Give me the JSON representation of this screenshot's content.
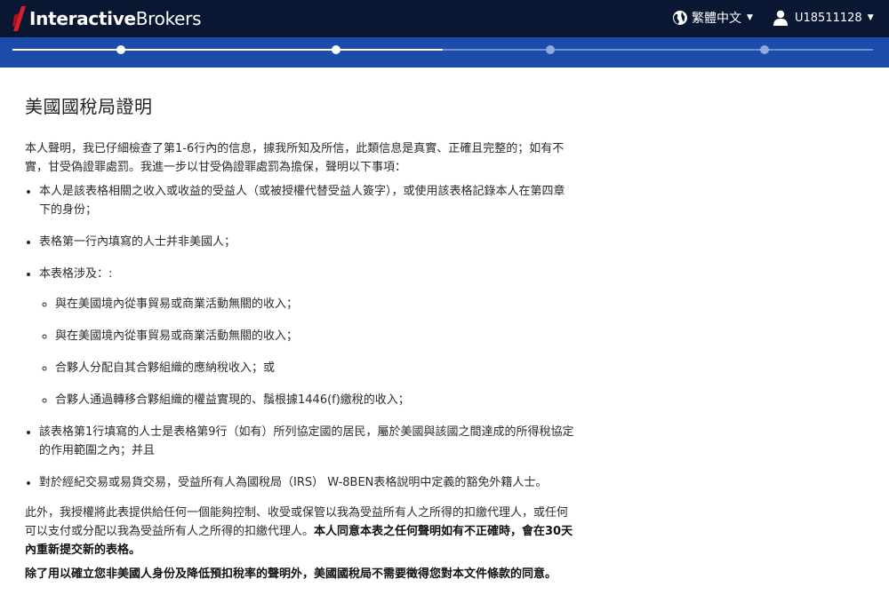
{
  "header": {
    "brand_bold": "Interactive",
    "brand_light": "Brokers",
    "language": "繁體中文",
    "username": "U18511128"
  },
  "progress": {
    "steps_total": 4,
    "steps_completed": 2,
    "fraction": 0.5
  },
  "page": {
    "title": "美國國稅局證明",
    "intro": "本人聲明，我已仔細檢查了第1-6行內的信息，據我所知及所信，此類信息是真實、正確且完整的；如有不實，甘受偽證罪處罰。我進一步以甘受偽證罪處罰為擔保，聲明以下事項：",
    "bullets": {
      "b1": "本人是該表格相關之收入或收益的受益人（或被授權代替受益人簽字），或使用該表格記錄本人在第四章下的身份；",
      "b2": "表格第一行內填寫的人士并非美國人；",
      "b3": "本表格涉及：:",
      "b4": "該表格第1行填寫的人士是表格第9行（如有）所列協定國的居民，屬於美國與該國之間達成的所得稅協定的作用範圍之內；并且",
      "b5": "對於經紀交易或易貨交易，受益所有人為國稅局（IRS） W-8BEN表格說明中定義的豁免外籍人士。"
    },
    "sub_bullets": {
      "s1": "與在美國境內從事貿易或商業活動無關的收入；",
      "s2": "與在美國境內從事貿易或商業活動無關的收入；",
      "s3": "合夥人分配自其合夥組織的應納稅收入；或",
      "s4": "合夥人通過轉移合夥組織的權益實現的、鬚根據1446(f)繳稅的收入；"
    },
    "authorization_normal": "此外，我授權將此表提供給任何一個能夠控制、收受或保管以我為受益所有人之所得的扣繳代理人，或任何可以支付或分配以我為受益所有人之所得的扣繳代理人。",
    "authorization_bold": "本人同意本表之任何聲明如有不正確時，會在30天內重新提交新的表格。",
    "consent_note": "除了用以確立您非美國人身份及降低預扣稅率的聲明外，美國國稅局不需要徵得您對本文件條款的同意。"
  },
  "colors": {
    "topbar": "#0a1733",
    "progress_bar": "#1c4ba9",
    "brand_red": "#d81e2c"
  },
  "icons": {
    "language": "globe-icon",
    "user": "user-icon",
    "dropdown": "caret-down-icon"
  }
}
